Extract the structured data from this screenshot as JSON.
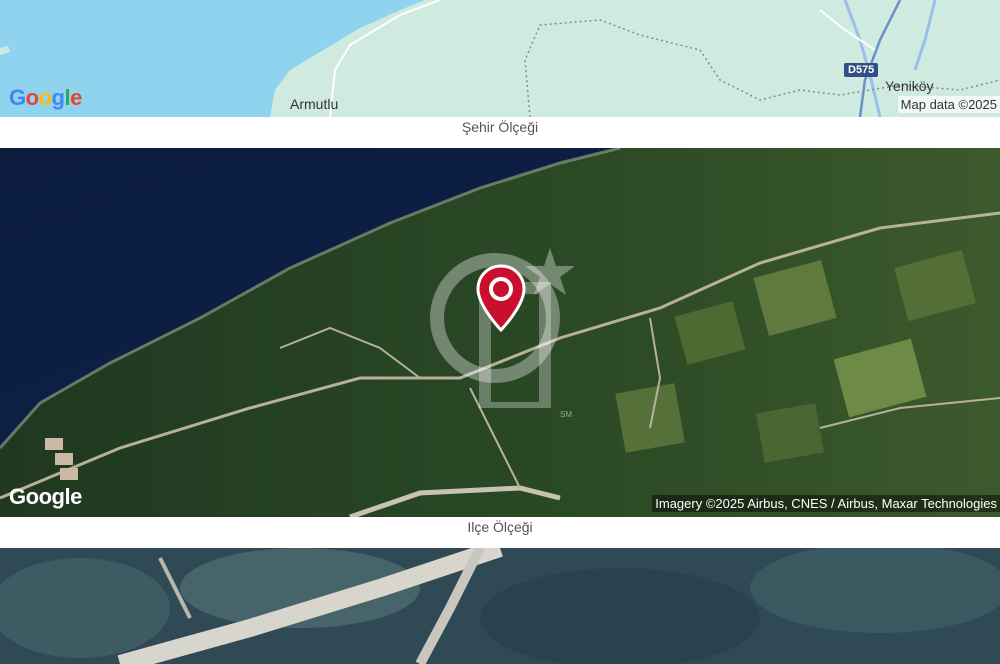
{
  "panels": {
    "city": {
      "caption": "Şehir Ölçeği",
      "labels": {
        "town_west": "Armutlu",
        "town_east": "Yeniköy",
        "road_shield": "D575"
      },
      "logo": [
        "G",
        "o",
        "o",
        "g",
        "l",
        "e"
      ],
      "credit": "Map data ©2025"
    },
    "district": {
      "caption": "Ilçe Ölçeği",
      "logo": [
        "G",
        "o",
        "o",
        "g",
        "l",
        "e"
      ],
      "credit": "Imagery ©2025 Airbus, CNES / Airbus, Maxar Technologies",
      "watermark": "CB",
      "watermark_mark": "SM"
    }
  },
  "colors": {
    "water": "#8fd3ef",
    "land": "#cfeadf",
    "marker": "#c8102e",
    "google_blue": "#4285f4",
    "google_red": "#ea4335",
    "google_yellow": "#fbbc05",
    "google_green": "#34a853"
  },
  "icons": {
    "marker": "location-pin-icon",
    "watermark": "agency-logo-watermark"
  }
}
